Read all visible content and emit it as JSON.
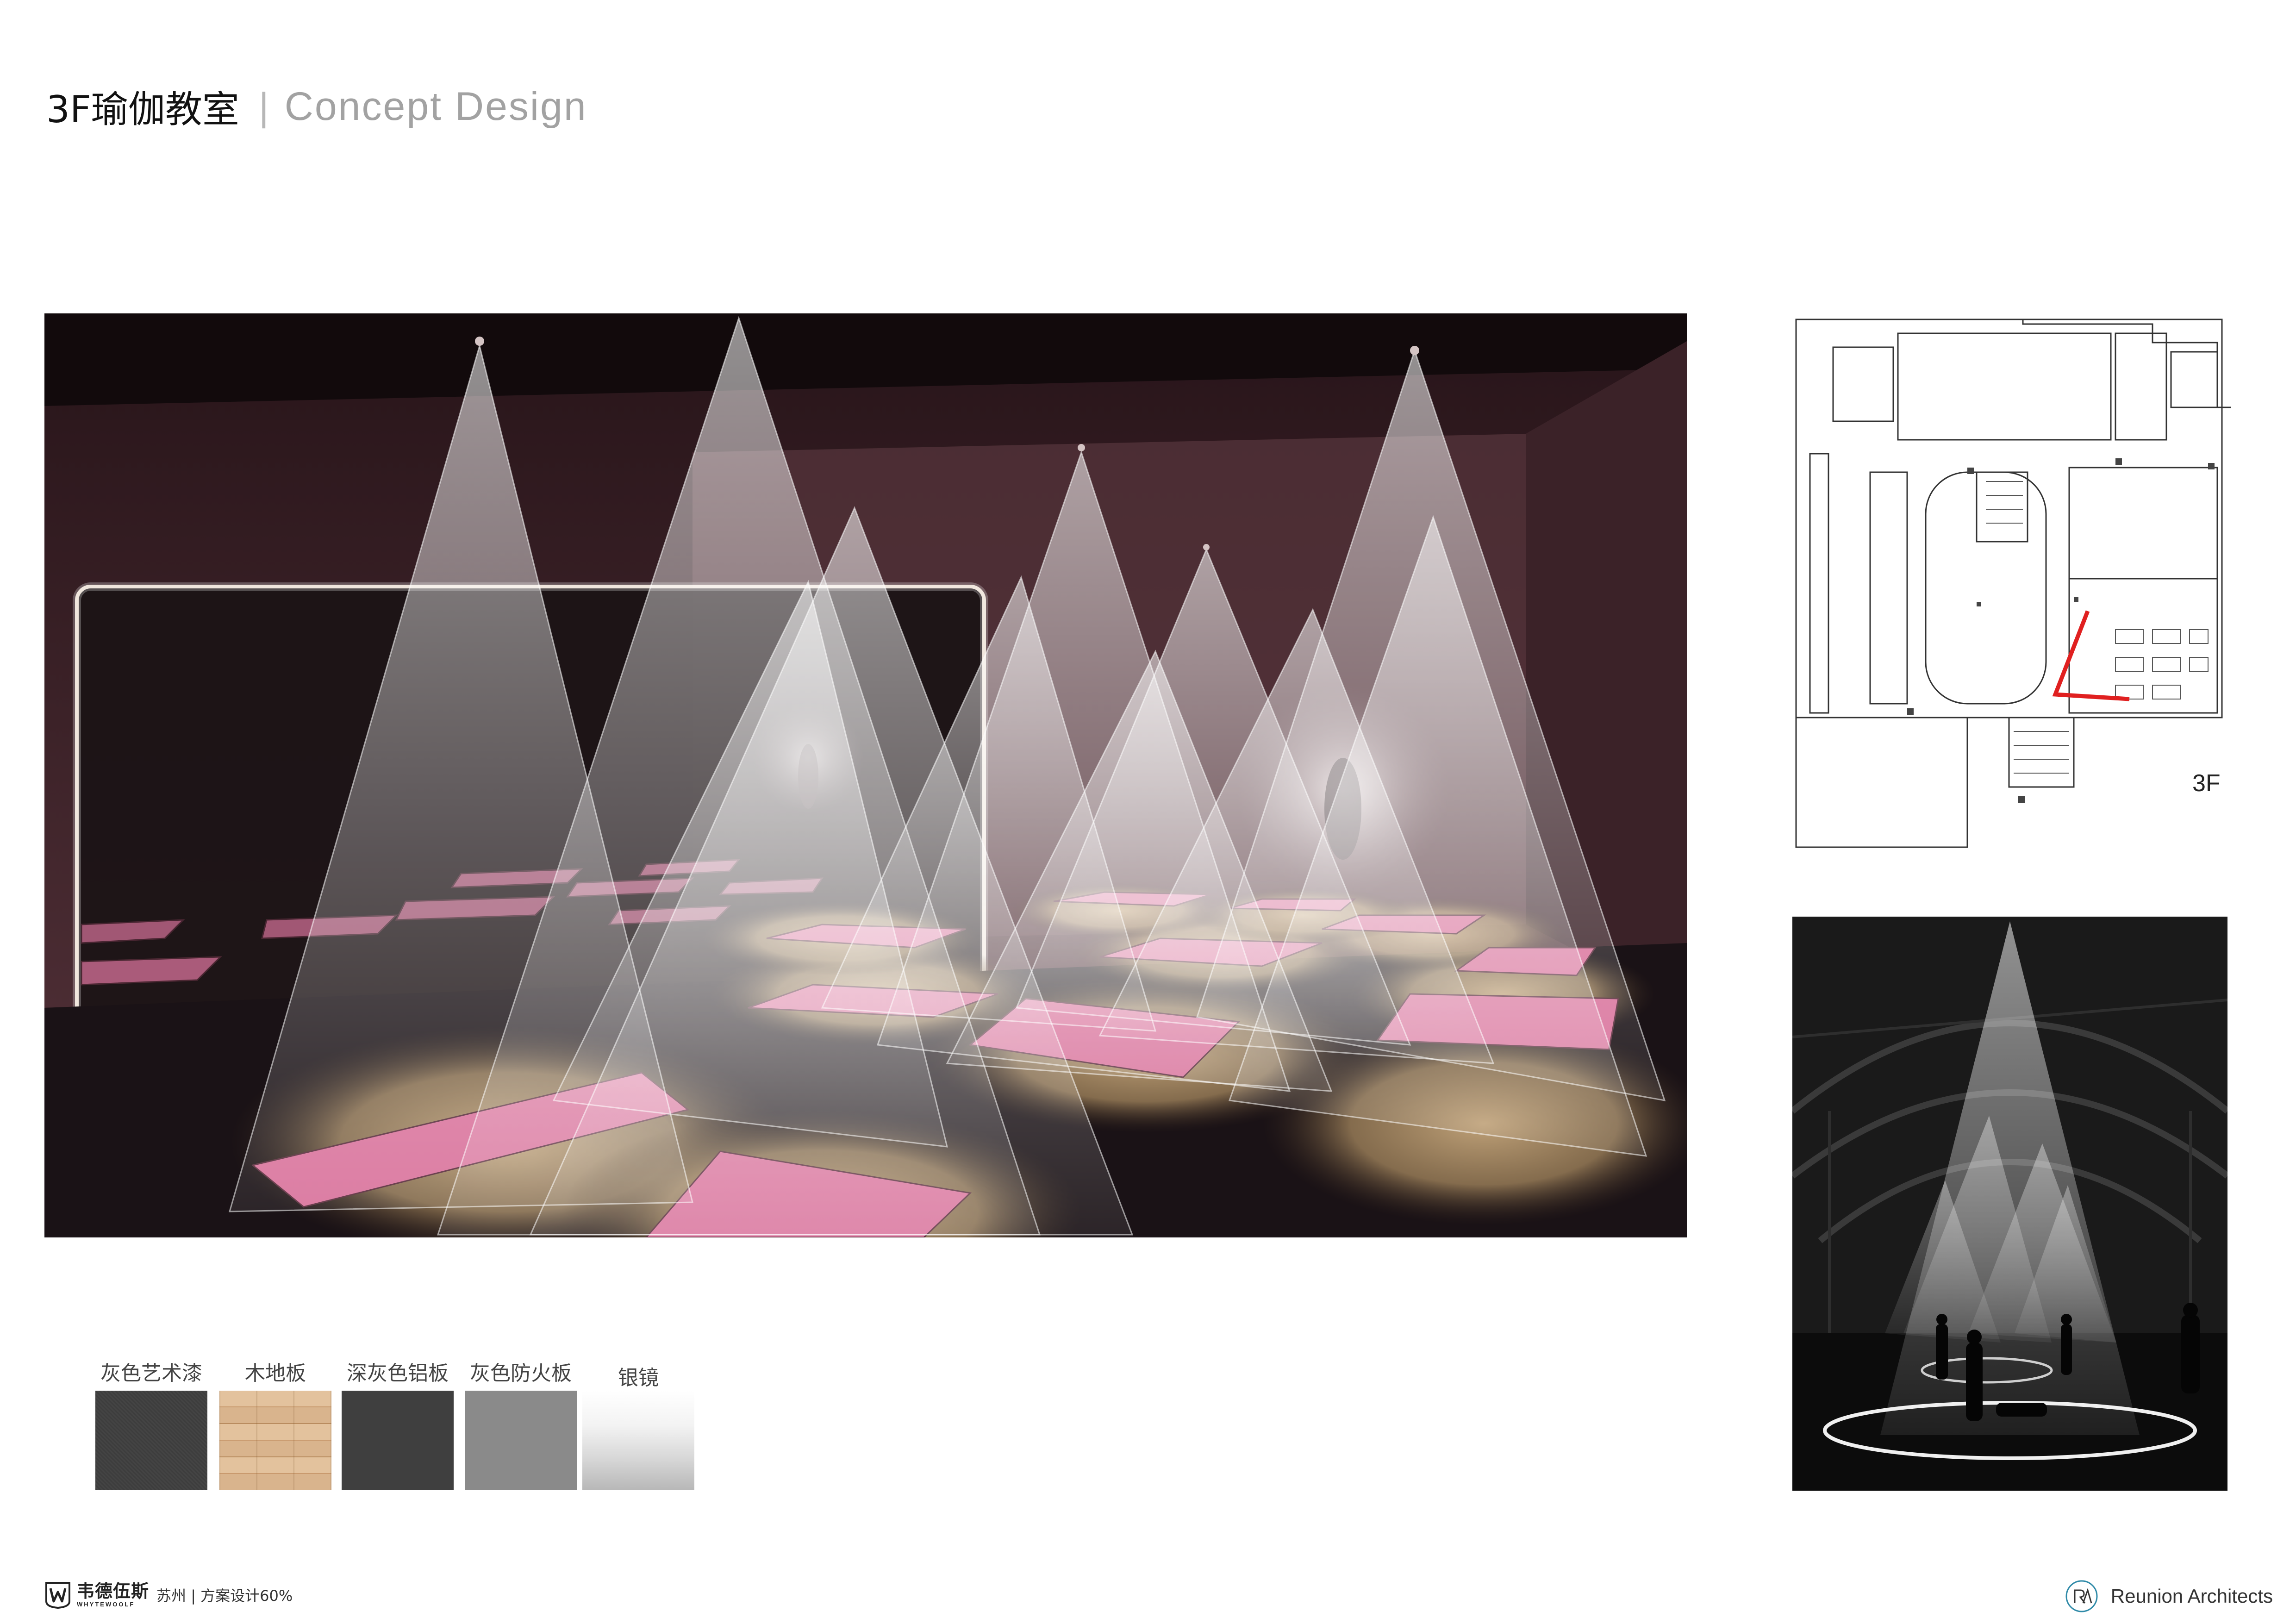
{
  "header": {
    "title": "3F瑜伽教室",
    "separator": "|",
    "subtitle": "Concept Design"
  },
  "floor_plan": {
    "label": "3F",
    "marker_color": "#e02020"
  },
  "materials": [
    {
      "label": "灰色艺术漆",
      "color": "#808080"
    },
    {
      "label": "木地板",
      "color": "#d4ab82"
    },
    {
      "label": "深灰色铝板",
      "color": "#3f3f3f"
    },
    {
      "label": "灰色防火板",
      "color": "#8a8a8a"
    },
    {
      "label": "银镜",
      "color": "#e6e6e6"
    }
  ],
  "footer": {
    "brand_cn": "韦德伍斯",
    "brand_en": "WHYTEWOOLF",
    "project": "苏州 | 方案设计60%",
    "architect": "Reunion Architects"
  },
  "colors": {
    "mat_pink": "#d9739c",
    "wall_dark": "#3a2128",
    "floor": "#1a1216",
    "wood_light": "#b7986e"
  }
}
